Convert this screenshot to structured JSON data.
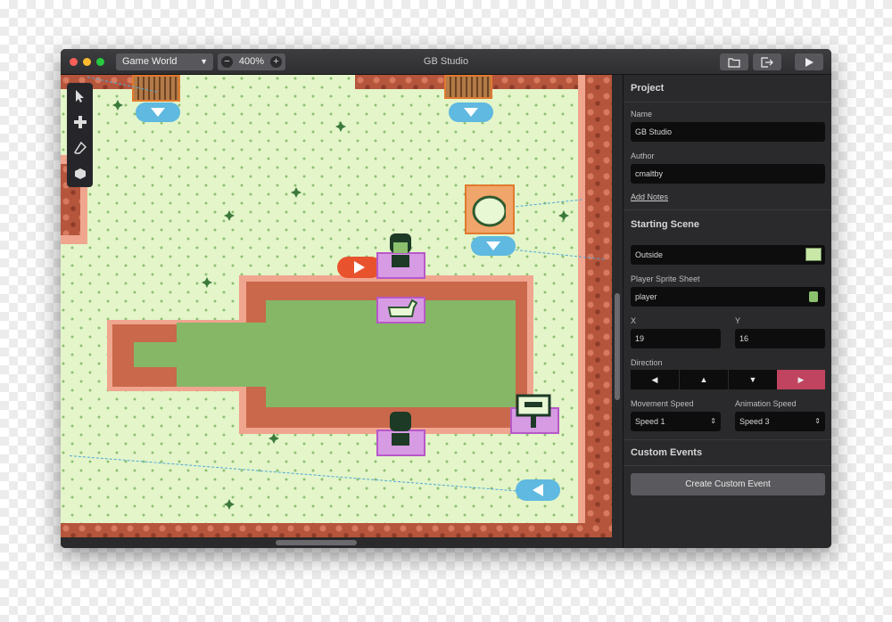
{
  "window": {
    "title": "GB Studio",
    "scene_select": "Game World",
    "zoom": "400%",
    "zoom_out": "−",
    "zoom_in": "+"
  },
  "panel": {
    "project_title": "Project",
    "name_label": "Name",
    "name_value": "GB Studio",
    "author_label": "Author",
    "author_value": "cmaltby",
    "add_notes": "Add Notes",
    "starting_scene_title": "Starting Scene",
    "scene_value": "Outside",
    "sprite_label": "Player Sprite Sheet",
    "sprite_value": "player",
    "x_label": "X",
    "x_value": "19",
    "y_label": "Y",
    "y_value": "16",
    "direction_label": "Direction",
    "direction_options": [
      "◀",
      "▲",
      "▼",
      "▶"
    ],
    "direction_selected": "▶",
    "movement_label": "Movement Speed",
    "movement_value": "Speed 1",
    "animation_label": "Animation Speed",
    "animation_value": "Speed 3",
    "custom_events_title": "Custom Events",
    "create_event_button": "Create Custom Event"
  },
  "icons": {
    "toolbar": [
      "select-icon",
      "add-icon",
      "eraser-icon",
      "paint-bucket-icon"
    ],
    "titlebar": [
      "folder-icon",
      "export-icon",
      "play-icon"
    ]
  },
  "colors": {
    "accent_direction": "#c0435f",
    "trigger_arrow": "#5fb9e0",
    "start_arrow": "#e8532e",
    "actor_outline": "#b758c8"
  }
}
